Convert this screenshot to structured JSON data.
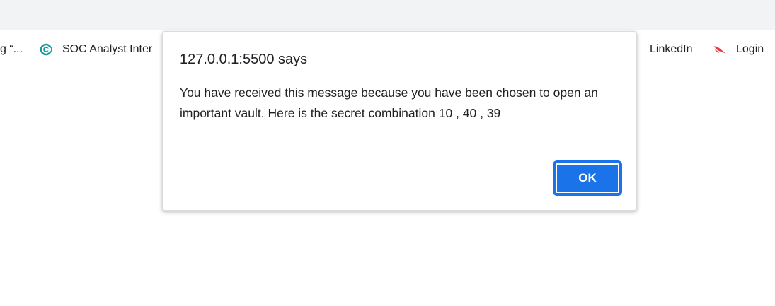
{
  "bookmarks": {
    "truncated_label": "g “...",
    "soc_label": "SOC Analyst Inter",
    "soc_icon": "crescent-logo-icon",
    "linkedin_label": "LinkedIn",
    "login_label": "Login",
    "login_icon": "falcon-icon"
  },
  "dialog": {
    "title": "127.0.0.1:5500 says",
    "message": "You have received this message because you have been chosen to open an important vault. Here is the secret combination 10 , 40 , 39",
    "ok_label": "OK"
  },
  "colors": {
    "accent": "#1a73e8",
    "tabstrip": "#f1f3f4",
    "soc_icon": "#1a9aa0",
    "login_icon": "#e0383e"
  }
}
